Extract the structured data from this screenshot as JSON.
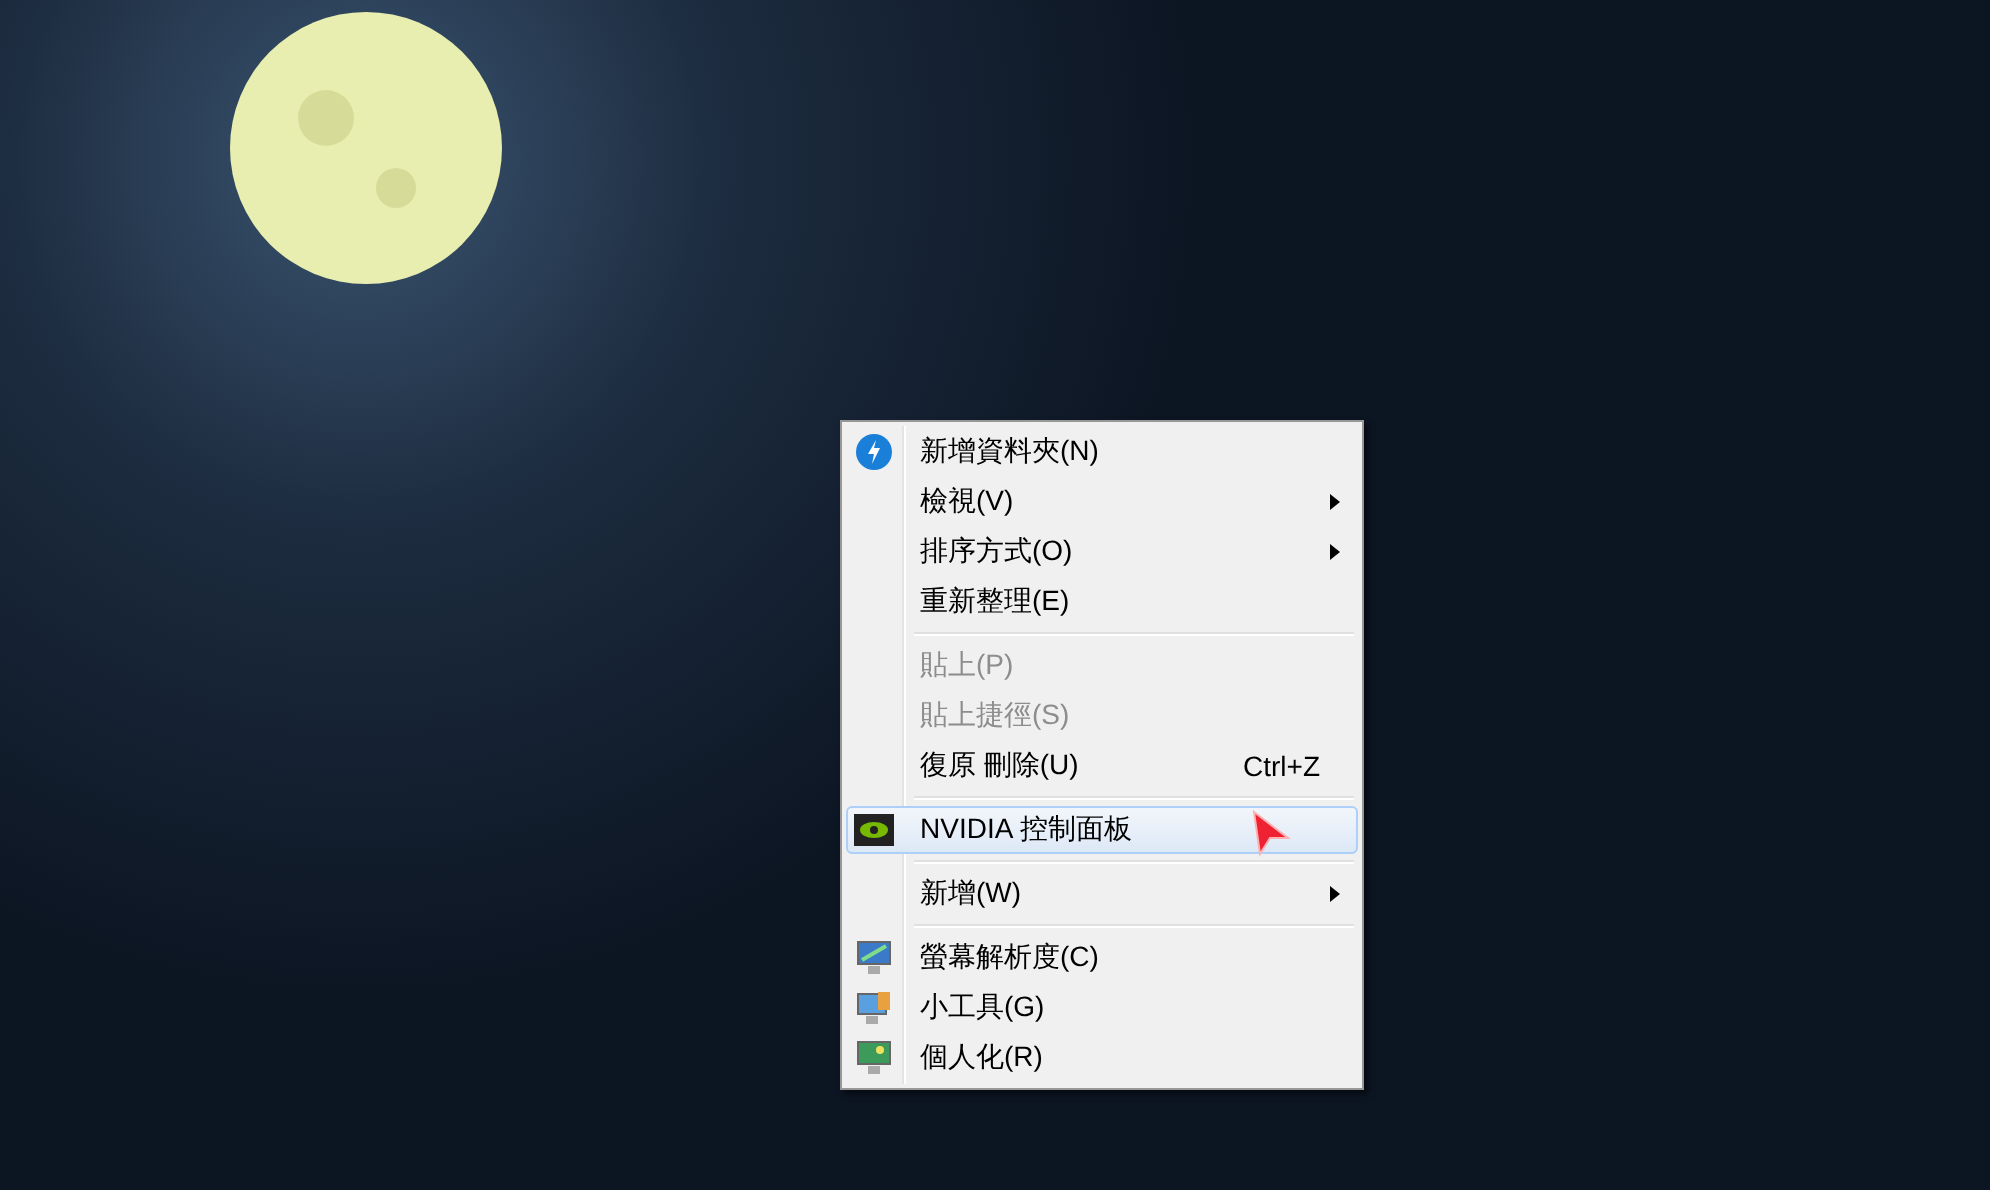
{
  "context_menu": {
    "groups": [
      [
        {
          "label": "新增資料夾(N)",
          "kind": "bolt",
          "disabled": false,
          "selected": false,
          "submenu": false
        },
        {
          "label": "檢視(V)",
          "kind": "plain",
          "disabled": false,
          "selected": false,
          "submenu": true
        },
        {
          "label": "排序方式(O)",
          "kind": "plain",
          "disabled": false,
          "selected": false,
          "submenu": true
        },
        {
          "label": "重新整理(E)",
          "kind": "plain",
          "disabled": false,
          "selected": false,
          "submenu": false
        }
      ],
      [
        {
          "label": "貼上(P)",
          "kind": "plain",
          "disabled": true,
          "selected": false,
          "submenu": false
        },
        {
          "label": "貼上捷徑(S)",
          "kind": "plain",
          "disabled": true,
          "selected": false,
          "submenu": false
        },
        {
          "label": "復原 刪除(U)",
          "shortcut": "Ctrl+Z",
          "kind": "plain",
          "disabled": false,
          "selected": false,
          "submenu": false
        }
      ],
      [
        {
          "label": "NVIDIA 控制面板",
          "kind": "chip",
          "disabled": false,
          "selected": true,
          "submenu": false
        }
      ],
      [
        {
          "label": "新增(W)",
          "kind": "plain",
          "disabled": false,
          "selected": false,
          "submenu": true
        }
      ],
      [
        {
          "label": "螢幕解析度(C)",
          "kind": "monitor",
          "disabled": false,
          "selected": false,
          "submenu": false
        },
        {
          "label": "小工具(G)",
          "kind": "gadget",
          "disabled": false,
          "selected": false,
          "submenu": false
        },
        {
          "label": "個人化(R)",
          "kind": "personalize",
          "disabled": false,
          "selected": false,
          "submenu": false
        }
      ]
    ]
  }
}
